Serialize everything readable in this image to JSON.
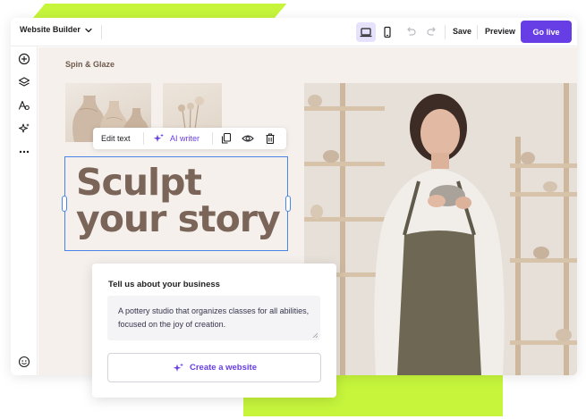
{
  "app": {
    "title": "Website Builder",
    "save_label": "Save",
    "preview_label": "Preview",
    "go_live_label": "Go live"
  },
  "site": {
    "name": "Spin & Glaze",
    "headline_line1": "Sculpt",
    "headline_line2": "your story"
  },
  "edit_toolbar": {
    "edit_text_label": "Edit text",
    "ai_writer_label": "AI writer"
  },
  "business_card": {
    "title": "Tell us about your business",
    "description": "A pottery studio that organizes classes for all abilities, focused on the joy of creation.",
    "create_button_label": "Create a website"
  },
  "left_toolbar": {
    "icons": [
      "add-icon",
      "layers-icon",
      "typography-icon",
      "ai-sparkle-icon",
      "more-icon",
      "help-icon"
    ]
  },
  "colors": {
    "accent": "#673de6",
    "brand_green": "#c6f53c",
    "headline": "#7b6559",
    "canvas_bg": "#f5f0ec",
    "selection": "#4a86e8"
  }
}
